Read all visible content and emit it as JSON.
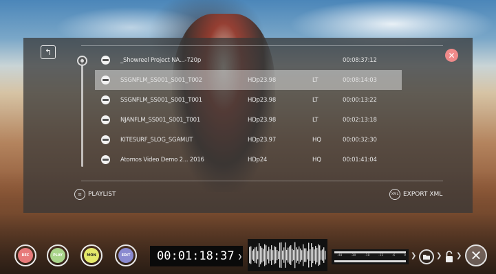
{
  "colors": {
    "rec": "#e77a7a",
    "play": "#a9d48a",
    "mon": "#e4e86a",
    "edit": "#8a8ad0",
    "close_accent": "#f08a8a"
  },
  "playlist": {
    "rows": [
      {
        "name": "_Showreel Project NA...-720p",
        "format": "",
        "codec": "",
        "duration": "00:08:37:12",
        "selected": false
      },
      {
        "name": "SSGNFLM_SS001_S001_T002",
        "format": "HDp23.98",
        "codec": "LT",
        "duration": "00:08:14:03",
        "selected": true
      },
      {
        "name": "SSGNFLM_SS001_S001_T001",
        "format": "HDp23.98",
        "codec": "LT",
        "duration": "00:00:13:22",
        "selected": false
      },
      {
        "name": "NJANFLM_SS001_S001_T001",
        "format": "HDp23.98",
        "codec": "LT",
        "duration": "00:02:13:18",
        "selected": false
      },
      {
        "name": "KITESURF_SLOG_SGAMUT",
        "format": "HDp23.97",
        "codec": "HQ",
        "duration": "00:00:32:30",
        "selected": false
      },
      {
        "name": "Atomos Video Demo 2... 2016",
        "format": "HDp24",
        "codec": "HQ",
        "duration": "00:01:41:04",
        "selected": false
      }
    ],
    "playlist_label": "PLAYLIST",
    "playlist_icon_text": "≡",
    "export_label": "EXPORT XML",
    "export_icon_text": "XML"
  },
  "controls": {
    "rec_label": "REC",
    "play_label": "PLAY",
    "mon_label": "MON",
    "edit_label": "EDIT",
    "timecode": "00:01:18:37",
    "meter_scale": [
      "-48",
      "-30",
      "-18",
      "-12",
      "-6",
      "0"
    ]
  },
  "icons": [
    "up-folder-icon",
    "close-icon",
    "clip-icon",
    "playlist-icon",
    "xml-icon",
    "folder-icon",
    "lock-icon",
    "exit-icon"
  ]
}
